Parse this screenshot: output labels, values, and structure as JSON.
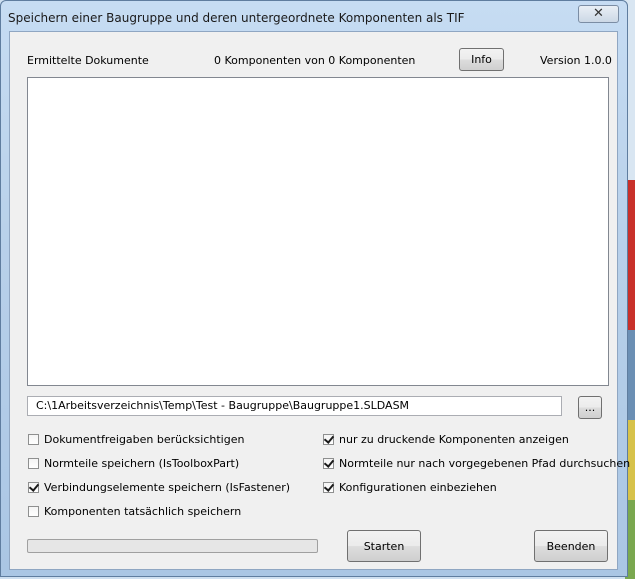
{
  "window": {
    "title": "Speichern einer Baugruppe und deren untergeordnete Komponenten als TIF",
    "close_glyph": "✕"
  },
  "header": {
    "documents_label": "Ermittelte Dokumente",
    "count_text": "0 Komponenten von 0 Komponenten",
    "info_button": "Info",
    "version": "Version 1.0.0"
  },
  "path": {
    "value": "C:\\1Arbeitsverzeichnis\\Temp\\Test - Baugruppe\\Baugruppe1.SLDASM",
    "browse_button": "..."
  },
  "options_left": [
    {
      "label": "Dokumentfreigaben berücksichtigen",
      "checked": false
    },
    {
      "label": "Normteile speichern (IsToolboxPart)",
      "checked": false
    },
    {
      "label": "Verbindungselemente speichern (IsFastener)",
      "checked": true
    },
    {
      "label": "Komponenten tatsächlich speichern",
      "checked": false
    }
  ],
  "options_right": [
    {
      "label": "nur zu druckende Komponenten anzeigen",
      "checked": true
    },
    {
      "label": "Normteile nur nach vorgegebenen Pfad durchsuchen",
      "checked": true
    },
    {
      "label": "Konfigurationen einbeziehen",
      "checked": true
    }
  ],
  "progress": {
    "value": 0
  },
  "footer": {
    "start_button": "Starten",
    "exit_button": "Beenden"
  }
}
